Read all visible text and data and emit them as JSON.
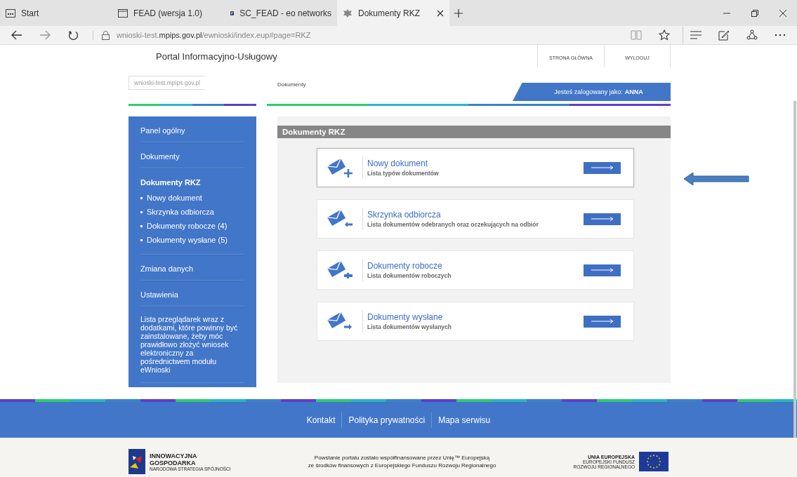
{
  "browser": {
    "tabs": [
      {
        "label": "Start",
        "kind": "app",
        "selected": false
      },
      {
        "label": "FEAD (wersja 1.0)",
        "kind": "page",
        "selected": false
      },
      {
        "label": "SC_FEAD - eo networks",
        "kind": "logo",
        "selected": false
      },
      {
        "label": "Dokumenty RKZ",
        "kind": "emblem",
        "selected": true
      }
    ],
    "url": {
      "prefix": "wnioski-test.",
      "domain": "mpips.gov.pl",
      "path": "/ewnioski/index.eup#page=RKZ"
    }
  },
  "header": {
    "title": "Portal Informacyjno-Usługowy",
    "nav": [
      "STRONA GŁÓWNA",
      "WYLOGUJ"
    ]
  },
  "breadcrumb": {
    "host": "wnioski-test.mpips.gov.pl",
    "current": "Dokumenty"
  },
  "login": {
    "label": "Jesteś zalogowany jako:",
    "user": "ANNA"
  },
  "sidebar": {
    "items": [
      {
        "label": "Panel ogólny",
        "selected": false
      },
      {
        "label": "Dokumenty",
        "selected": false
      },
      {
        "label": "Dokumenty RKZ",
        "selected": true,
        "children": [
          {
            "label": "Nowy dokument"
          },
          {
            "label": "Skrzynka odbiorcza"
          },
          {
            "label": "Dokumenty robocze (4)"
          },
          {
            "label": "Dokumenty wysłane (5)"
          }
        ]
      },
      {
        "label": "Zmiana danych",
        "selected": false
      },
      {
        "label": "Ustawienia",
        "selected": false
      }
    ],
    "note": "Lista przeglądarek wraz z dodatkami, które powinny być zainstalowane, żeby móc prawidłowo złożyć wniosek elektroniczny za pośrednictwem modułu eWnioski"
  },
  "panel": {
    "title": "Dokumenty RKZ",
    "cards": [
      {
        "kind": "new",
        "title": "Nowy dokument",
        "subtitle": "Lista typów dokumentów",
        "selected": true
      },
      {
        "kind": "inbox",
        "title": "Skrzynka odbiorcza",
        "subtitle": "Lista dokumentów odebranych oraz oczekujących na odbiór",
        "selected": false
      },
      {
        "kind": "draft",
        "title": "Dokumenty robocze",
        "subtitle": "Lista dokumentów roboczych",
        "selected": false
      },
      {
        "kind": "sent",
        "title": "Dokumenty wysłane",
        "subtitle": "Lista dokumentów wysłanych",
        "selected": false
      }
    ]
  },
  "footer": {
    "links": [
      "Kontakt",
      "Polityka prywatności",
      "Mapa serwisu"
    ],
    "funding": [
      "Powstanie portalu zostało współfinansowane przez Unię™ Europejską",
      "ze środków finansowych z Europejskiego Funduszu Rozwoju Regionalnego"
    ],
    "left_logo": [
      "INNOWACYJNA",
      "GOSPODARKA",
      "NARODOWA STRATEGIA SPÓJNOŚCI"
    ],
    "right_logo": [
      "UNIA EUROPEJSKA",
      "EUROPEJSKI FUNDUSZ",
      "ROZWOJU REGIONALNEGO"
    ]
  }
}
